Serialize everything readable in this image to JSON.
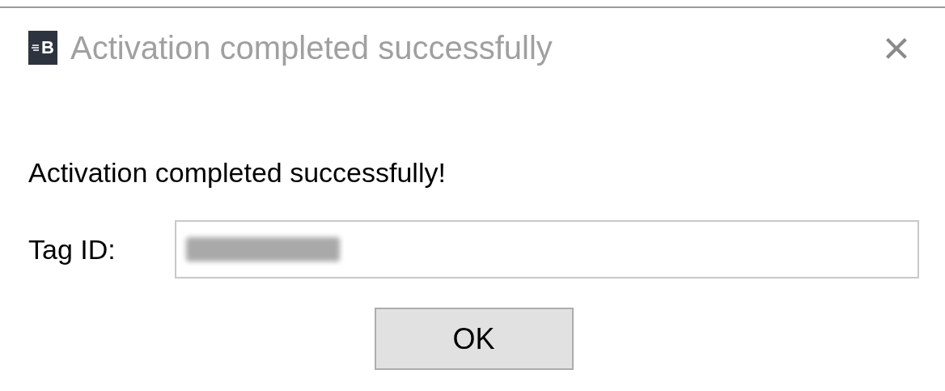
{
  "window": {
    "title": "Activation completed successfully",
    "icon_letter": "B",
    "close": "×"
  },
  "message": "Activation completed successfully!",
  "tag_id": {
    "label": "Tag ID:",
    "redacted": true
  },
  "buttons": [
    "OK"
  ]
}
